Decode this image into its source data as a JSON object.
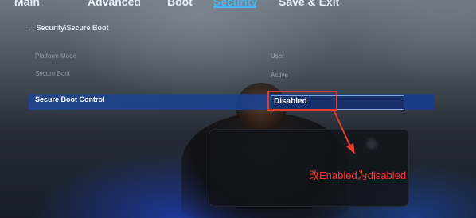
{
  "menu": {
    "items": [
      {
        "label": "Main",
        "active": false
      },
      {
        "label": "Advanced",
        "active": false
      },
      {
        "label": "Boot",
        "active": false
      },
      {
        "label": "Security",
        "active": true
      },
      {
        "label": "Save & Exit",
        "active": false
      }
    ]
  },
  "breadcrumb": "← Security\\Secure Boot",
  "settings": [
    {
      "label": "Platform Mode",
      "value": "User"
    },
    {
      "label": "Secure Boot",
      "value": "Active"
    }
  ],
  "selected_setting": {
    "label": "Secure Boot Control",
    "value": "Disabled"
  },
  "annotation": {
    "text": "改Enabled为disabled",
    "color": "#f23a2c"
  },
  "colors": {
    "accent": "#47b6f2",
    "highlight": "#e53a2e",
    "selection": "#1e4696"
  }
}
